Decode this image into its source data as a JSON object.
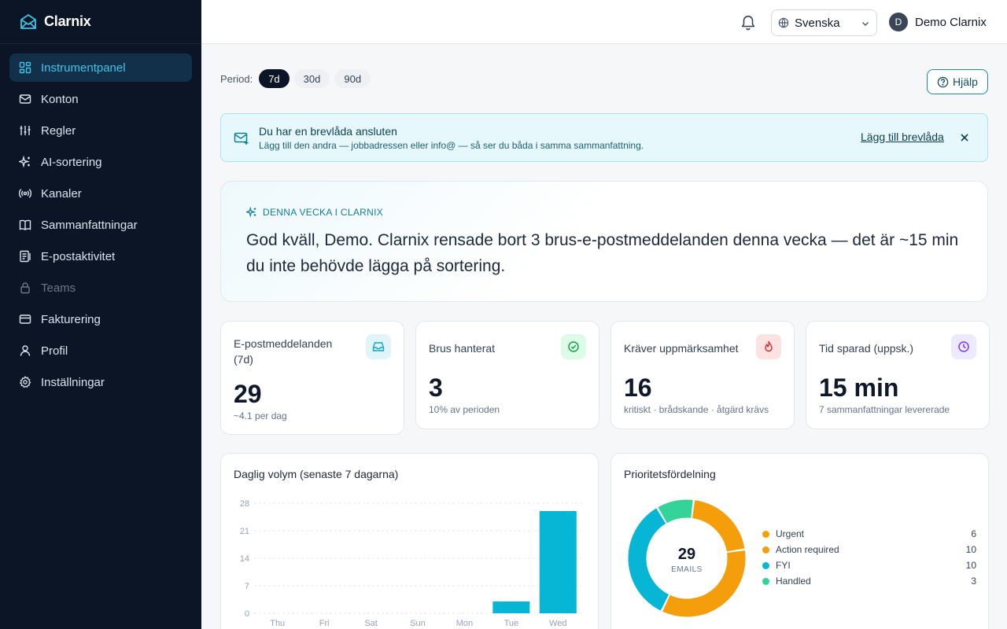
{
  "brand": {
    "name": "Clarnix"
  },
  "sidebar": {
    "items": [
      {
        "label": "Instrumentpanel",
        "icon": "dashboard-icon",
        "active": true
      },
      {
        "label": "Konton",
        "icon": "mail-icon"
      },
      {
        "label": "Regler",
        "icon": "sliders-icon"
      },
      {
        "label": "AI-sortering",
        "icon": "sparkles-icon"
      },
      {
        "label": "Kanaler",
        "icon": "broadcast-icon"
      },
      {
        "label": "Sammanfattningar",
        "icon": "book-icon"
      },
      {
        "label": "E-postaktivitet",
        "icon": "activity-icon"
      },
      {
        "label": "Teams",
        "icon": "lock-icon",
        "disabled": true
      },
      {
        "label": "Fakturering",
        "icon": "credit-card-icon"
      },
      {
        "label": "Profil",
        "icon": "user-icon"
      },
      {
        "label": "Inställningar",
        "icon": "gear-icon"
      }
    ]
  },
  "topbar": {
    "language": "Svenska",
    "user": {
      "initial": "D",
      "name": "Demo Clarnix"
    }
  },
  "period": {
    "label": "Period:",
    "options": [
      "7d",
      "30d",
      "90d"
    ],
    "selected": "7d"
  },
  "help_label": "Hjälp",
  "banner": {
    "title": "Du har en brevlåda ansluten",
    "text": "Lägg till den andra — jobbadressen eller info@ — så ser du båda i samma sammanfattning.",
    "link": "Lägg till brevlåda"
  },
  "hero": {
    "eyebrow": "DENNA VECKA I CLARNIX",
    "message": "God kväll, Demo. Clarnix rensade bort 3 brus-e-postmeddelanden denna vecka — det är ~15 min du inte behövde lägga på sortering."
  },
  "stats": [
    {
      "title": "E-postmeddelanden (7d)",
      "value": "29",
      "sub": "~4.1 per dag",
      "icon": "inbox-icon",
      "color": "#10a7c9"
    },
    {
      "title": "Brus hanterat",
      "value": "3",
      "sub": "10% av perioden",
      "icon": "check-circle-icon",
      "color": "#16a34a"
    },
    {
      "title": "Kräver uppmärksamhet",
      "value": "16",
      "sub": "kritiskt · brådskande · åtgärd krävs",
      "icon": "flame-icon",
      "color": "#dc2626"
    },
    {
      "title": "Tid sparad (uppsk.)",
      "value": "15 min",
      "sub": "7 sammanfattningar levererade",
      "icon": "clock-icon",
      "color": "#7c3aed"
    }
  ],
  "daily_chart": {
    "title": "Daglig volym (senaste 7 dagarna)",
    "color": "#06b6d4"
  },
  "priority_chart": {
    "title": "Prioritetsfördelning",
    "center_value": "29",
    "center_label": "EMAILS"
  },
  "chart_data": [
    {
      "type": "bar",
      "title": "Daglig volym (senaste 7 dagarna)",
      "categories": [
        "Thu",
        "Fri",
        "Sat",
        "Sun",
        "Mon",
        "Tue",
        "Wed"
      ],
      "values": [
        0,
        0,
        0,
        0,
        0,
        3,
        26
      ],
      "yticks": [
        0,
        7,
        14,
        21,
        28
      ],
      "ylim": [
        0,
        28
      ],
      "grid": true
    },
    {
      "type": "pie",
      "title": "Prioritetsfördelning",
      "labels": [
        "Urgent",
        "Action required",
        "FYI",
        "Handled"
      ],
      "values": [
        6,
        10,
        10,
        3
      ],
      "colors": [
        "#f59e0b",
        "#f59e0b",
        "#06b6d4",
        "#34d399"
      ]
    }
  ]
}
